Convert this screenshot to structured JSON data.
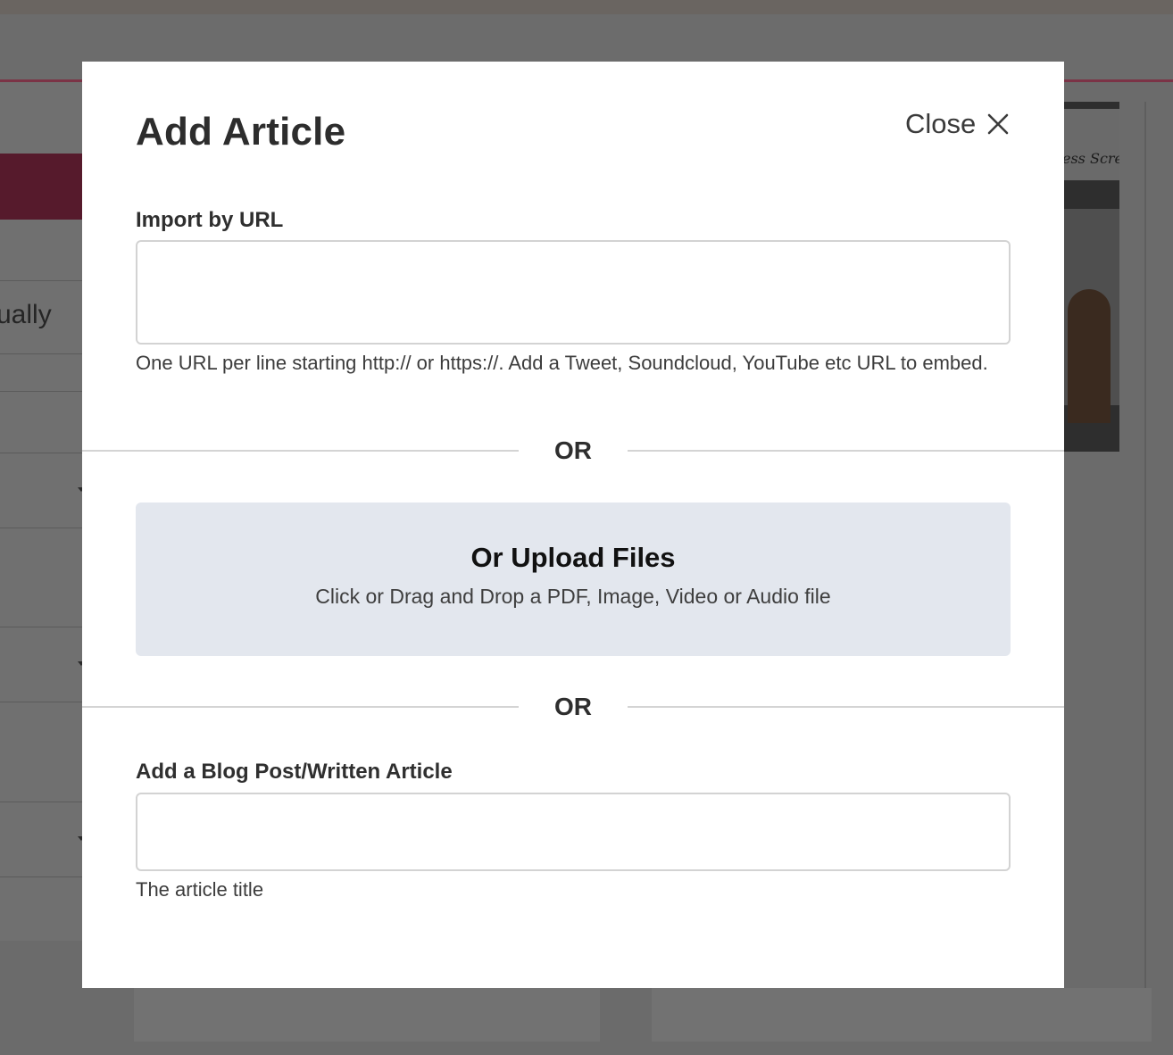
{
  "background": {
    "partial_text": "ually",
    "image_sketch_text": "ess Scre"
  },
  "modal": {
    "title": "Add Article",
    "close_label": "Close",
    "close_icon": "close-icon",
    "import_url": {
      "label": "Import by URL",
      "value": "",
      "placeholder": "",
      "help": "One URL per line starting http:// or https://. Add a Tweet, Soundcloud, YouTube etc URL to embed."
    },
    "divider_text": "OR",
    "upload": {
      "title": "Or Upload Files",
      "subtitle": "Click or Drag and Drop a PDF, Image, Video or Audio file"
    },
    "blog_post": {
      "label": "Add a Blog Post/Written Article",
      "value": "",
      "placeholder": "",
      "help": "The article title"
    }
  },
  "colors": {
    "overlay": "#6b6b6b",
    "modal_bg": "#ffffff",
    "upload_bg": "#e3e7ee",
    "accent": "#561a2c",
    "input_border": "#d3d3d3"
  }
}
